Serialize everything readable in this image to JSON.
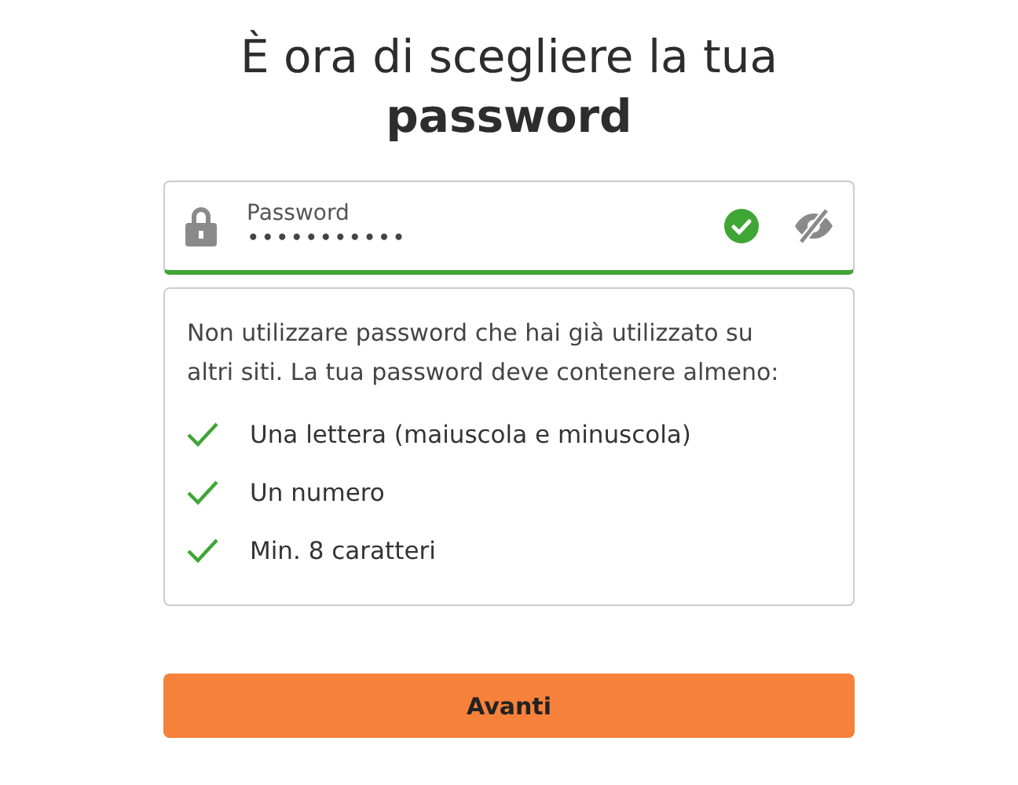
{
  "heading": "È ora di scegliere la tua **password**",
  "password_field": {
    "label": "Password",
    "value": "•••••••••••",
    "valid": true,
    "visible": false
  },
  "hint": "Non utilizzare password che hai già utilizzato su altri siti. La tua password deve contenere almeno:",
  "rules": [
    {
      "text": "Una lettera (maiuscola e minuscola)",
      "checked": true
    },
    {
      "text": "Un numero",
      "checked": true
    },
    {
      "text": "Min. 8 caratteri",
      "checked": true
    }
  ],
  "button": "Avanti"
}
